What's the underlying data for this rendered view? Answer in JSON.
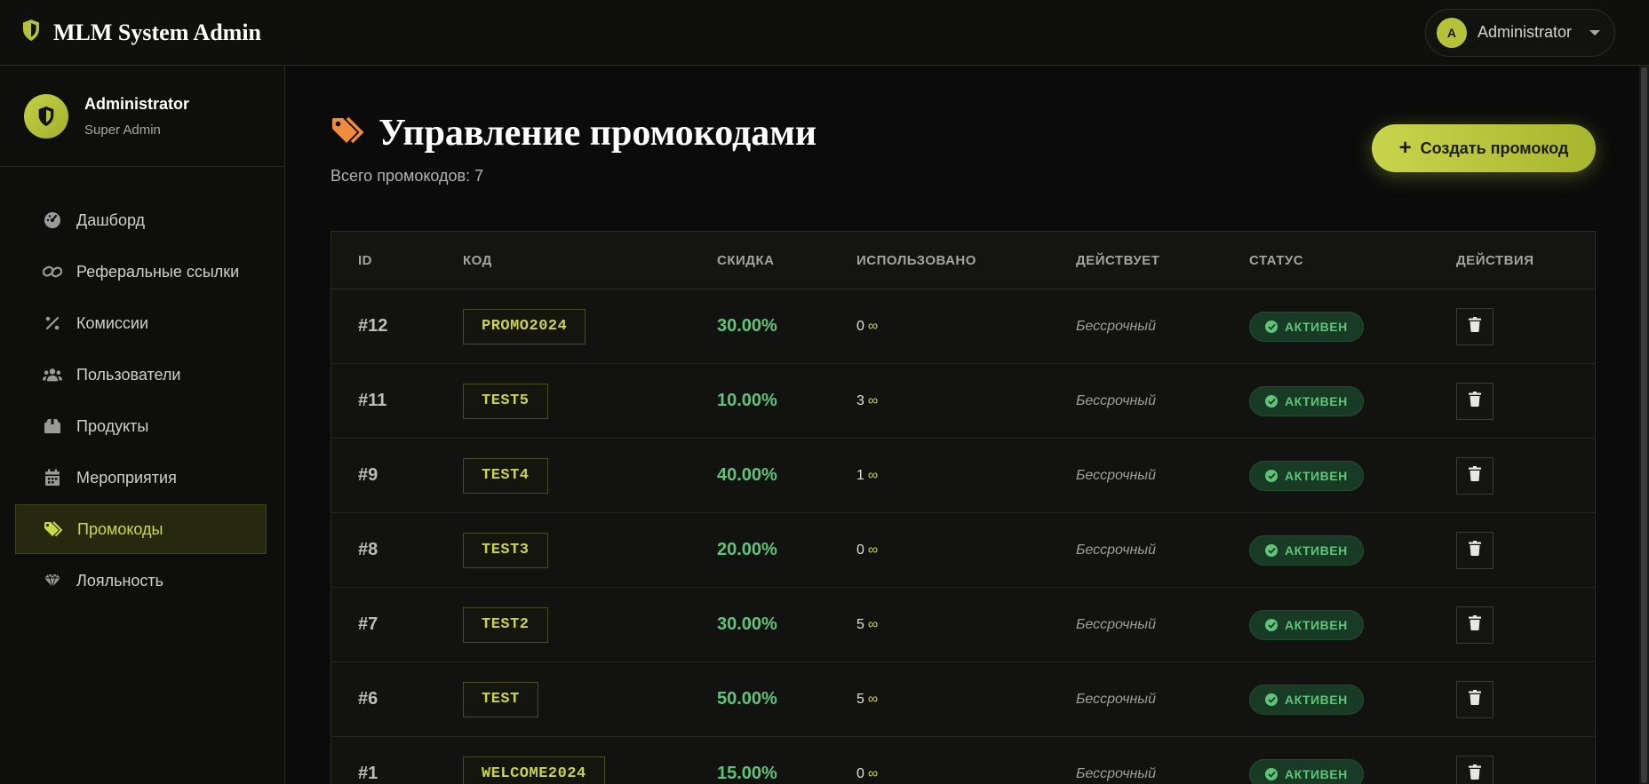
{
  "app": {
    "title": "MLM System Admin"
  },
  "header": {
    "user_initial": "A",
    "user_name": "Administrator"
  },
  "profile": {
    "name": "Administrator",
    "role": "Super Admin"
  },
  "sidebar": {
    "items": [
      {
        "label": "Дашборд",
        "icon": "dashboard-icon"
      },
      {
        "label": "Реферальные ссылки",
        "icon": "link-icon"
      },
      {
        "label": "Комиссии",
        "icon": "percent-icon"
      },
      {
        "label": "Пользователи",
        "icon": "users-icon"
      },
      {
        "label": "Продукты",
        "icon": "box-icon"
      },
      {
        "label": "Мероприятия",
        "icon": "calendar-icon"
      },
      {
        "label": "Промокоды",
        "icon": "tags-icon",
        "active": true
      },
      {
        "label": "Лояльность",
        "icon": "gem-icon"
      }
    ]
  },
  "page": {
    "title": "Управление промокодами",
    "subtitle": "Всего промокодов: 7",
    "create_label": "Создать промокод"
  },
  "table": {
    "columns": [
      "ID",
      "КОД",
      "СКИДКА",
      "ИСПОЛЬЗОВАНО",
      "ДЕЙСТВУЕТ",
      "СТАТУС",
      "ДЕЙСТВИЯ"
    ],
    "rows": [
      {
        "id": "#12",
        "code": "PROMO2024",
        "discount": "30.00%",
        "used": "0",
        "used_limit": "∞",
        "valid": "Бессрочный",
        "status": "АКТИВЕН"
      },
      {
        "id": "#11",
        "code": "TEST5",
        "discount": "10.00%",
        "used": "3",
        "used_limit": "∞",
        "valid": "Бессрочный",
        "status": "АКТИВЕН"
      },
      {
        "id": "#9",
        "code": "TEST4",
        "discount": "40.00%",
        "used": "1",
        "used_limit": "∞",
        "valid": "Бессрочный",
        "status": "АКТИВЕН"
      },
      {
        "id": "#8",
        "code": "TEST3",
        "discount": "20.00%",
        "used": "0",
        "used_limit": "∞",
        "valid": "Бессрочный",
        "status": "АКТИВЕН"
      },
      {
        "id": "#7",
        "code": "TEST2",
        "discount": "30.00%",
        "used": "5",
        "used_limit": "∞",
        "valid": "Бессрочный",
        "status": "АКТИВЕН"
      },
      {
        "id": "#6",
        "code": "TEST",
        "discount": "50.00%",
        "used": "5",
        "used_limit": "∞",
        "valid": "Бессрочный",
        "status": "АКТИВЕН"
      },
      {
        "id": "#1",
        "code": "WELCOME2024",
        "discount": "15.00%",
        "used": "0",
        "used_limit": "∞",
        "valid": "Бессрочный",
        "status": "АКТИВЕН"
      }
    ]
  },
  "colors": {
    "accent": "#c9d44c",
    "success": "#5fc47a",
    "background": "#0b0b0b"
  }
}
